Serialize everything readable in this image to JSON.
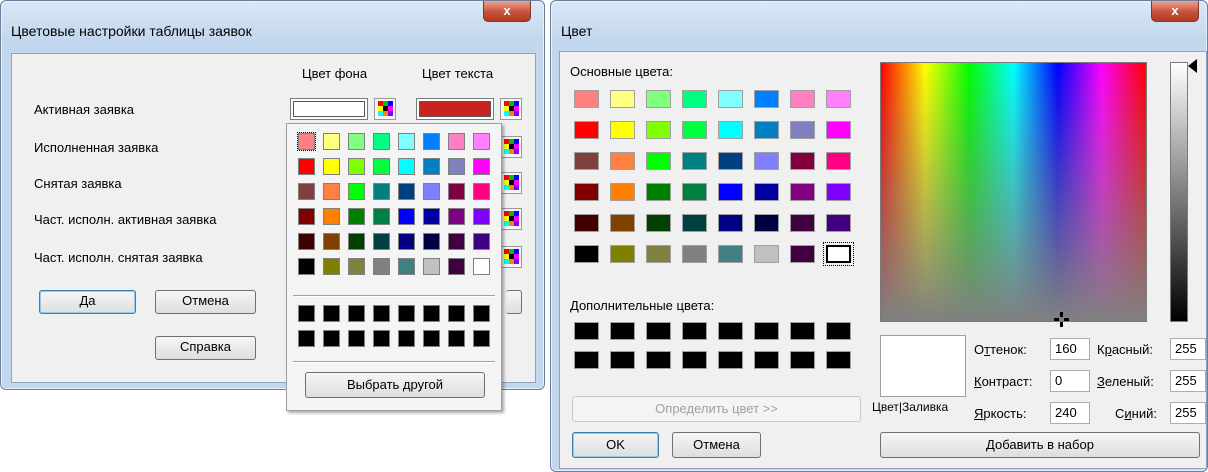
{
  "left_dialog": {
    "title": "Цветовые настройки таблицы заявок",
    "close_glyph": "x",
    "col_bg": "Цвет фона",
    "col_text": "Цвет текста",
    "rows": [
      {
        "label": "Активная заявка",
        "bg": "#ffffff",
        "fg": "#c8231c"
      },
      {
        "label": "Исполненная заявка"
      },
      {
        "label": "Снятая заявка"
      },
      {
        "label": "Част. исполн. активная заявка"
      },
      {
        "label": "Част. исполн. снятая заявка"
      }
    ],
    "ok": "Да",
    "cancel": "Отмена",
    "help": "Справка",
    "popup": {
      "colors": [
        [
          "#ff8080",
          "#ffff80",
          "#80ff80",
          "#00ff80",
          "#80ffff",
          "#0080ff",
          "#ff80c0",
          "#ff80ff"
        ],
        [
          "#ff0000",
          "#ffff00",
          "#80ff00",
          "#00ff40",
          "#00ffff",
          "#0080c0",
          "#8080c0",
          "#ff00ff"
        ],
        [
          "#804040",
          "#ff8040",
          "#00ff00",
          "#008080",
          "#004080",
          "#8080ff",
          "#800040",
          "#ff0080"
        ],
        [
          "#800000",
          "#ff8000",
          "#008000",
          "#008040",
          "#0000ff",
          "#0000a0",
          "#800080",
          "#8000ff"
        ],
        [
          "#400000",
          "#804000",
          "#004000",
          "#004040",
          "#000080",
          "#000040",
          "#400040",
          "#400080"
        ],
        [
          "#000000",
          "#808000",
          "#808040",
          "#808080",
          "#408080",
          "#c0c0c0",
          "#400040",
          "#ffffff"
        ],
        [
          "#000000",
          "#000000",
          "#000000",
          "#000000",
          "#000000",
          "#000000",
          "#000000",
          "#000000"
        ],
        [
          "#000000",
          "#000000",
          "#000000",
          "#000000",
          "#000000",
          "#000000",
          "#000000",
          "#000000"
        ]
      ],
      "other_button": "Выбрать другой"
    }
  },
  "right_dialog": {
    "title": "Цвет",
    "close_glyph": "x",
    "basic_label": "Основные цвета:",
    "basic_colors": [
      [
        "#ff8080",
        "#ffff80",
        "#80ff80",
        "#00ff80",
        "#80ffff",
        "#0080ff",
        "#ff80c0",
        "#ff80ff"
      ],
      [
        "#ff0000",
        "#ffff00",
        "#80ff00",
        "#00ff40",
        "#00ffff",
        "#0080c0",
        "#8080c0",
        "#ff00ff"
      ],
      [
        "#804040",
        "#ff8040",
        "#00ff00",
        "#008080",
        "#004080",
        "#8080ff",
        "#800040",
        "#ff0080"
      ],
      [
        "#800000",
        "#ff8000",
        "#008000",
        "#008040",
        "#0000ff",
        "#0000a0",
        "#800080",
        "#8000ff"
      ],
      [
        "#400000",
        "#804000",
        "#004000",
        "#004040",
        "#000080",
        "#000040",
        "#400040",
        "#400080"
      ],
      [
        "#000000",
        "#808000",
        "#808040",
        "#808080",
        "#408080",
        "#c0c0c0",
        "#400040",
        "#ffffff"
      ]
    ],
    "custom_label": "Дополнительные цвета:",
    "custom_colors": [
      [
        "#000000",
        "#000000",
        "#000000",
        "#000000",
        "#000000",
        "#000000",
        "#000000",
        "#000000"
      ],
      [
        "#000000",
        "#000000",
        "#000000",
        "#000000",
        "#000000",
        "#000000",
        "#000000",
        "#000000"
      ]
    ],
    "define_button": "Определить цвет >>",
    "ok": "OK",
    "cancel": "Отмена",
    "color_solid_label": "Цвет|Заливка",
    "hue_label": "Оттенок:",
    "hue": "160",
    "sat_label": "Контраст:",
    "sat": "0",
    "lum_label": "Яркость:",
    "lum": "240",
    "red_label": "Красный:",
    "red": "255",
    "green_label": "Зеленый:",
    "green": "255",
    "blue_label": "Синий:",
    "blue": "255",
    "add_button": "Добавить в набор",
    "preview_color": "#ffffff"
  }
}
